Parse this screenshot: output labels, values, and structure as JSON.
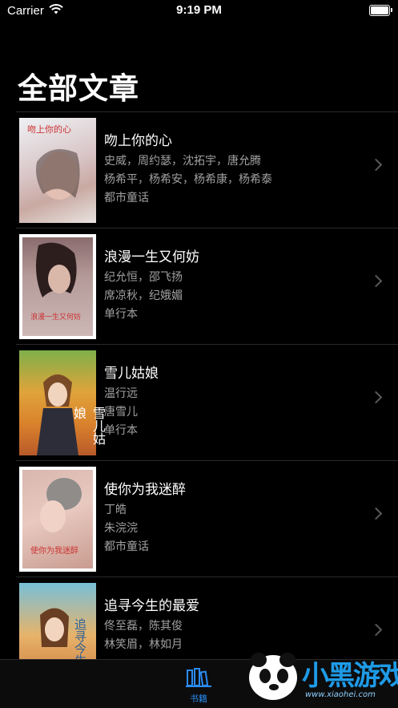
{
  "status_bar": {
    "carrier": "Carrier",
    "time": "9:19 PM"
  },
  "page_title": "全部文章",
  "books": [
    {
      "title": "吻上你的心",
      "line1": "史威，周约瑟，沈拓宇，唐允腾",
      "line2": "杨希平，杨希安，杨希康，杨希泰",
      "line3": "都市童话",
      "cover_text": "吻上你的心"
    },
    {
      "title": "浪漫一生又何妨",
      "line1": "纪允恒，邵飞扬",
      "line2": "席凉秋，纪娥媚",
      "line3": "单行本",
      "cover_text": "浪漫一生又何妨"
    },
    {
      "title": "雪儿姑娘",
      "line1": "温行远",
      "line2": "唐雪儿",
      "line3": "单行本",
      "cover_text": "雪儿姑娘"
    },
    {
      "title": "使你为我迷醉",
      "line1": "丁皓",
      "line2": "朱浣浣",
      "line3": "都市童话",
      "cover_text": "使你为我迷醉"
    },
    {
      "title": "追寻今生的最爱",
      "line1": "佟至磊，陈其俊",
      "line2": "林笑眉，林如月",
      "line3": "",
      "cover_text": "追寻今生"
    }
  ],
  "tab_bar": {
    "tabs": [
      {
        "label": "书籍",
        "icon": "books-icon",
        "color": "#2a8bf2"
      }
    ]
  },
  "watermark": {
    "brand": "小黑游戏",
    "url": "www.xiaohei.com"
  },
  "colors": {
    "accent": "#2a8bf2",
    "background": "#000000",
    "secondary_text": "#a0a0a0"
  }
}
